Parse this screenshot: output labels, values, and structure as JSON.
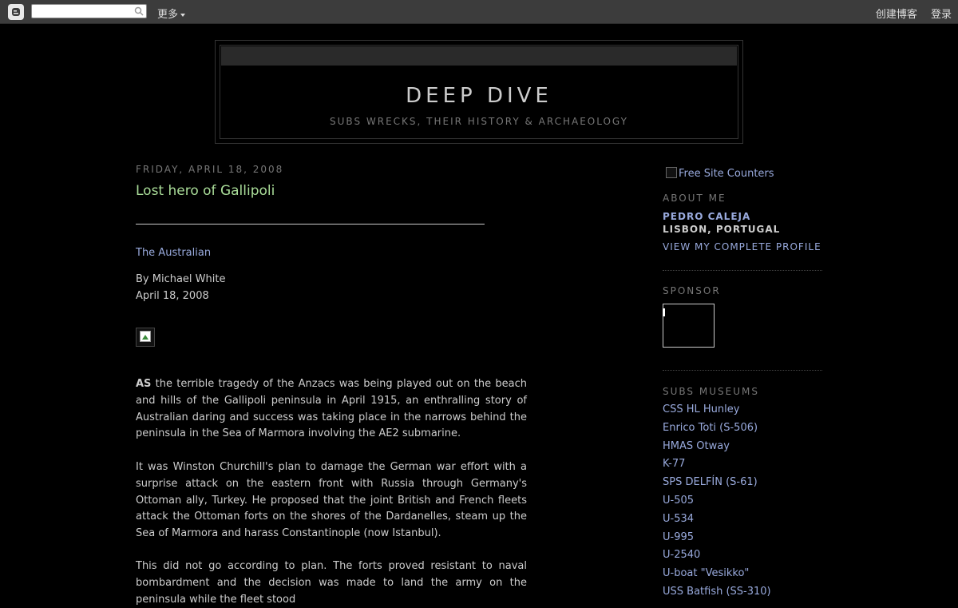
{
  "navbar": {
    "search_placeholder": "",
    "more_label": "更多",
    "create_blog": "创建博客",
    "login": "登录"
  },
  "header": {
    "title": "DEEP DIVE",
    "description": "SUBS WRECKS, THEIR HISTORY & ARCHAEOLOGY"
  },
  "post": {
    "date": "FRIDAY, APRIL 18, 2008",
    "title": "Lost hero of Gallipoli",
    "source": "The Australian",
    "author": "By Michael White",
    "byline_date": "April 18, 2008",
    "p1_lead": "AS",
    "p1_rest": " the terrible tragedy of the Anzacs was being played out on the beach and hills of the Gallipoli peninsula in April 1915, an enthralling story of Australian daring and success was taking place in the narrows behind the peninsula in the Sea of Marmora involving the AE2 submarine.",
    "p2": "It was Winston Churchill's plan to damage the German war effort with a surprise attack on the eastern front with Russia through Germany's Ottoman ally, Turkey. He proposed that the joint British and French fleets attack the Ottoman forts on the shores of the Dardanelles, steam up the Sea of Marmora and harass Constantinople (now Istanbul).",
    "p3": "This did not go according to plan. The forts proved resistant to naval bombardment and the decision was made to land the army on the peninsula while the fleet stood"
  },
  "sidebar": {
    "counter_text": "Free Site Counters",
    "about_heading": "ABOUT ME",
    "profile_name": "PEDRO CALEJA",
    "profile_location": "LISBON, PORTUGAL",
    "profile_link": "VIEW MY COMPLETE PROFILE",
    "sponsor_heading": "SPONSOR",
    "museums_heading": "SUBS MUSEUMS",
    "museums": [
      "CSS HL Hunley",
      "Enrico Toti (S-506)",
      "HMAS Otway",
      "K-77",
      "SPS DELFÍN (S-61)",
      "U-505",
      "U-534",
      "U-995",
      "U-2540",
      "U-boat \"Vesikko\"",
      "USS Batfish (SS-310)"
    ]
  }
}
